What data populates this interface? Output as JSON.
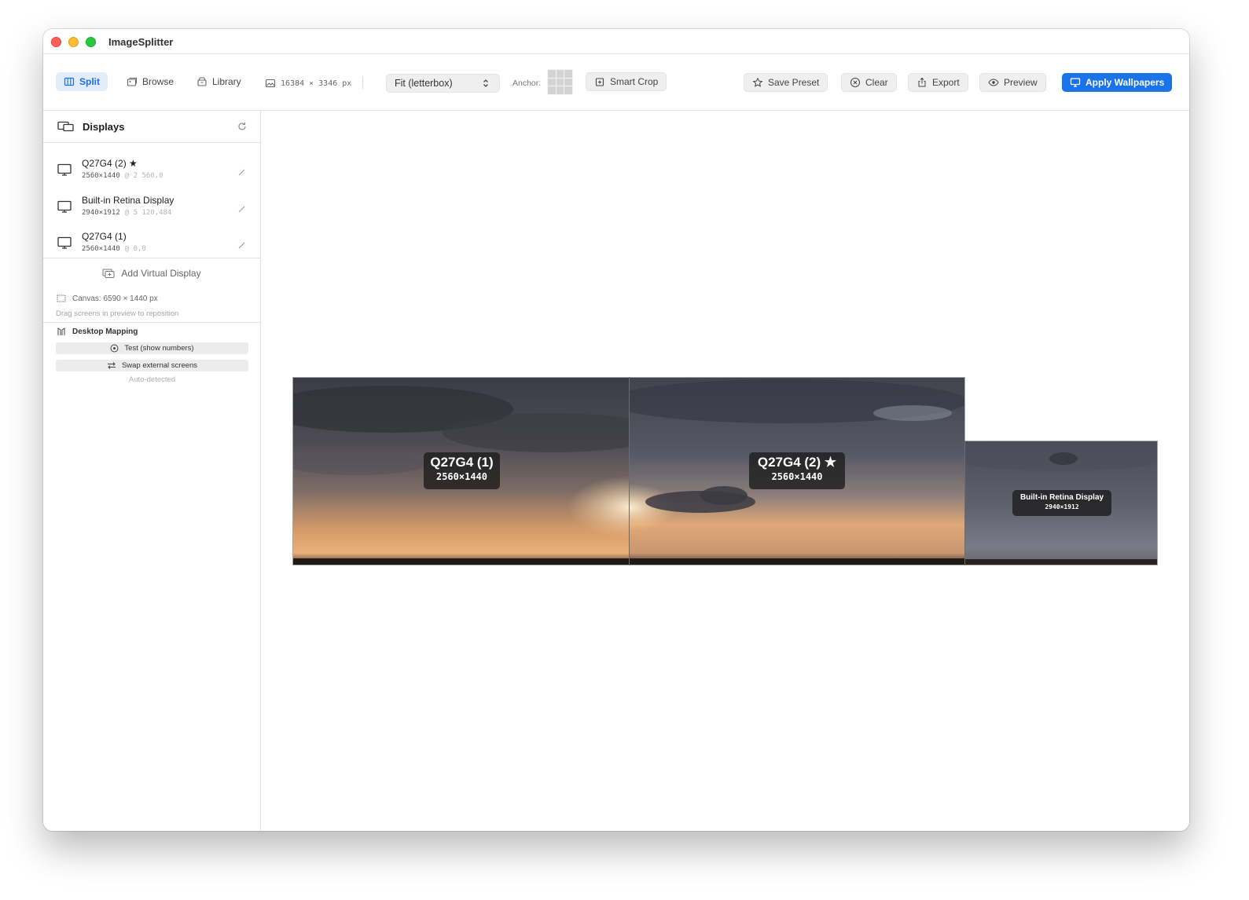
{
  "window": {
    "title": "ImageSplitter",
    "controls": [
      "close",
      "minimize",
      "maximize"
    ]
  },
  "toolbar": {
    "tabs": [
      {
        "label": "Split",
        "icon": "columns-icon",
        "active": true
      },
      {
        "label": "Browse",
        "icon": "photo-stack-icon",
        "active": false
      },
      {
        "label": "Library",
        "icon": "archive-icon",
        "active": false
      }
    ],
    "image_size": "16384 × 3346 px",
    "fit_mode": "Fit (letterbox)",
    "anchor_label": "Anchor:",
    "smart_crop": "Smart Crop",
    "save_preset": "Save Preset",
    "clear": "Clear",
    "export": "Export",
    "preview": "Preview",
    "apply": "Apply Wallpapers",
    "accent_color": "#1a73e8"
  },
  "sidebar": {
    "title": "Displays",
    "displays": [
      {
        "name": "Q27G4 (2) ★",
        "resolution": "2560×1440",
        "position": "@ 2 560,0"
      },
      {
        "name": "Built-in Retina Display",
        "resolution": "2940×1912",
        "position": "@ 5 120,484"
      },
      {
        "name": "Q27G4 (1)",
        "resolution": "2560×1440",
        "position": "@ 0,0"
      }
    ],
    "add_virtual": "Add Virtual Display",
    "canvas": "Canvas: 6590 × 1440 px",
    "drag_hint": "Drag screens in preview to reposition",
    "mapping_title": "Desktop Mapping",
    "test_button": "Test (show numbers)",
    "swap_button": "Swap external screens",
    "auto_detected": "Auto-detected"
  },
  "preview": {
    "screens": [
      {
        "name": "Q27G4 (1)",
        "resolution": "2560×1440"
      },
      {
        "name": "Q27G4 (2) ★",
        "resolution": "2560×1440"
      },
      {
        "name": "Built-in Retina Display",
        "resolution": "2940×1912"
      }
    ]
  }
}
